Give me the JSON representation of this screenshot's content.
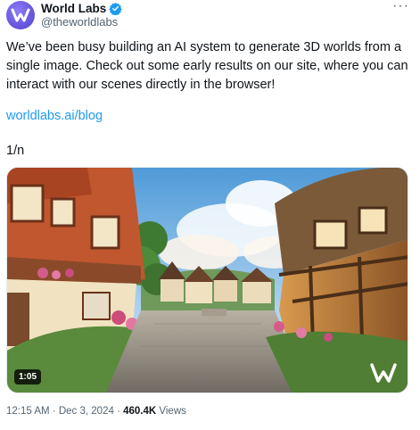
{
  "author": {
    "display_name": "World Labs",
    "handle": "@theworldlabs",
    "verified": true
  },
  "tweet": {
    "text": "We’ve been busy building an AI system to generate 3D worlds from a single image. Check out some early results on our site, where you can interact with our scenes directly in the browser!",
    "link": "worldlabs.ai/blog",
    "thread_marker": "1/n"
  },
  "media": {
    "type": "video",
    "duration": "1:05"
  },
  "meta": {
    "time": "12:15 AM",
    "separator": "·",
    "date": "Dec 3, 2024",
    "views_count": "460.4K",
    "views_label": "Views"
  },
  "icons": {
    "avatar": "world-labs-logo-icon",
    "verified": "verified-badge-icon",
    "more": "more-options-icon",
    "video_overlay": "world-labs-watermark-icon"
  },
  "colors": {
    "link": "#1d9bf0",
    "verified": "#1d9bf0",
    "secondary_text": "#536471",
    "primary_text": "#0f1419"
  }
}
